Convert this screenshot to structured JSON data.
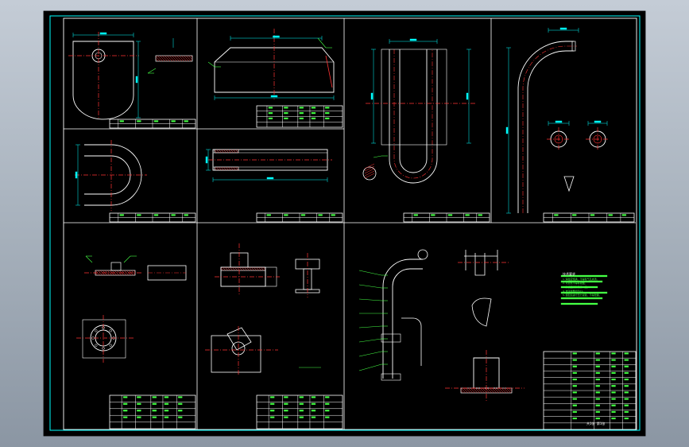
{
  "canvas": {
    "background": "#000000",
    "frame_color": "#00ffff",
    "line_color": "#ffffff",
    "center_color": "#ff3333",
    "dim_color": "#00ffff",
    "note_color": "#44ff44"
  },
  "technical_notes": {
    "title": "技术要求",
    "lines": [
      "1.焊缝应饱满，不得有气孔夹渣。",
      "2.弯管处不得有褶皱。",
      "3.外表面涂防锈漆一遍。",
      "4.未注倒角均为C1。",
      "5.装配后进行压力试验，不得泄漏。"
    ]
  },
  "title_block": {
    "scale": "共1张 第1张"
  }
}
